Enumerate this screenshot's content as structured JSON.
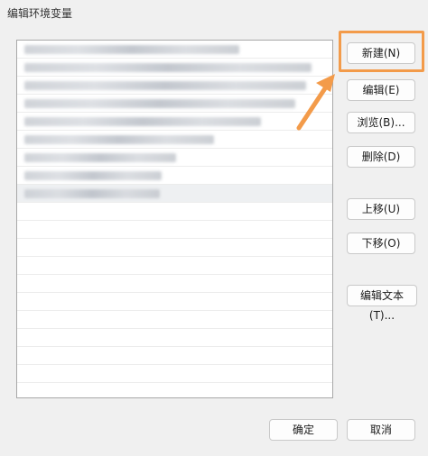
{
  "window": {
    "title": "编辑环境变量"
  },
  "list": {
    "rows_blurred": 8,
    "total_rows": 20
  },
  "buttons": {
    "new": "新建(N)",
    "edit": "编辑(E)",
    "browse": "浏览(B)...",
    "delete": "删除(D)",
    "move_up": "上移(U)",
    "move_down": "下移(O)",
    "edit_text": "编辑文本(T)..."
  },
  "footer": {
    "ok": "确定",
    "cancel": "取消"
  },
  "annotation": {
    "highlight_color": "#f39b4a",
    "arrow_color": "#f39b4a"
  }
}
